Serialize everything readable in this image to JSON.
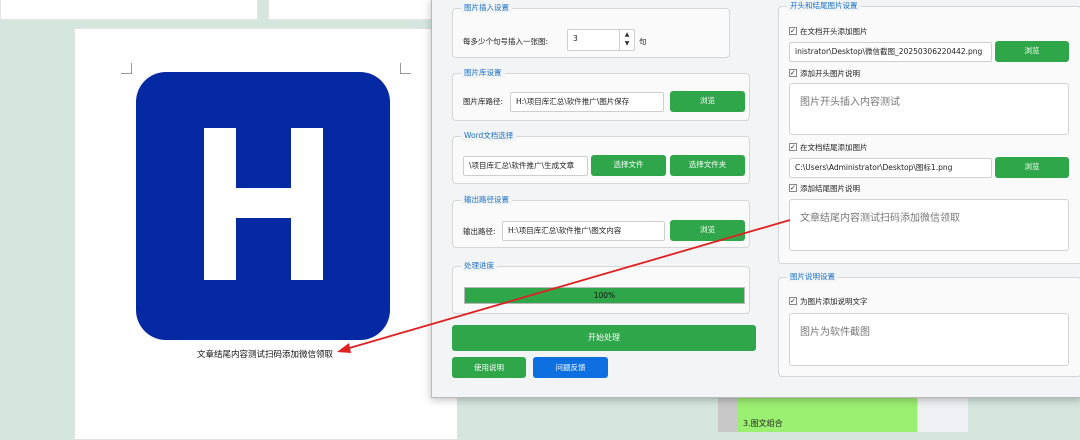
{
  "document": {
    "caption": "文章结尾内容测试扫码添加微信领取",
    "logo_letter": "H",
    "logo_color": "#0528a3",
    "side_panel_text": "3.图文组合"
  },
  "image_insert": {
    "title": "图片插入设置",
    "label": "每多少个句号插入一张图:",
    "value": "3",
    "unit": "句"
  },
  "library": {
    "title": "图片库设置",
    "label": "图片库路径:",
    "path": "H:\\项目库汇总\\软件推广\\图片保存",
    "browse": "浏览"
  },
  "word": {
    "title": "Word文档选择",
    "path": "\\项目库汇总\\软件推广\\生成文章",
    "select_file": "选择文件",
    "select_folder": "选择文件夹"
  },
  "output": {
    "title": "输出路径设置",
    "label": "输出路径:",
    "path": "H:\\项目库汇总\\软件推广\\图文内容",
    "browse": "浏览"
  },
  "progress": {
    "title": "处理进度",
    "value": 1.0,
    "text": "100%"
  },
  "actions": {
    "start": "开始处理",
    "help": "使用说明",
    "feedback": "问题反馈"
  },
  "head_tail": {
    "title": "开头和结尾图片设置",
    "add_head_image": "在文档开头添加图片",
    "head_path": "inistrator\\Desktop\\微信截图_20250306220442.png",
    "browse": "浏览",
    "add_head_caption": "添加开头图片说明",
    "head_caption_text": "图片开头插入内容测试",
    "add_tail_image": "在文档结尾添加图片",
    "tail_path": "C:\\Users\\Administrator\\Desktop\\图标1.png",
    "add_tail_caption": "添加结尾图片说明",
    "tail_caption_text": "文章结尾内容测试扫码添加微信领取"
  },
  "caption_settings": {
    "title": "图片说明设置",
    "add_caption": "为图片添加说明文字",
    "caption_text": "图片为软件截图"
  },
  "colors": {
    "accent_green": "#2fa64a",
    "accent_blue": "#0d6fe0",
    "group_title": "#1a6fc6",
    "arrow": "#e02020"
  }
}
